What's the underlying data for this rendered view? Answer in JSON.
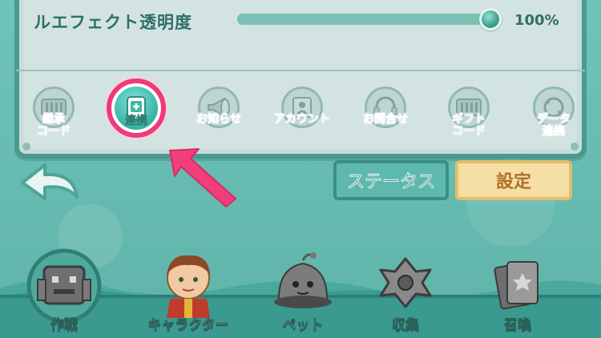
{
  "settings": {
    "effect_opacity_label": "ルエフェクト透明度",
    "effect_opacity_value": "100%",
    "effect_opacity_fraction": 1.0
  },
  "buttons": [
    {
      "label": "継承\nコード",
      "icon": "handover-code-icon",
      "active": false
    },
    {
      "label": "連携",
      "icon": "link-device-icon",
      "active": true
    },
    {
      "label": "お知らせ",
      "icon": "news-icon",
      "active": false
    },
    {
      "label": "アカウント",
      "icon": "account-icon",
      "active": false
    },
    {
      "label": "お問合せ",
      "icon": "support-icon",
      "active": false
    },
    {
      "label": "ギフト\nコード",
      "icon": "gift-code-icon",
      "active": false
    },
    {
      "label": "データ\n連携",
      "icon": "data-link-icon",
      "active": false
    }
  ],
  "tabs": {
    "status_label": "ステータス",
    "settings_label": "設定"
  },
  "nav": [
    {
      "label": "作戦",
      "icon": "battle-icon"
    },
    {
      "label": "キャラクター",
      "icon": "character-icon"
    },
    {
      "label": "ペット",
      "icon": "pet-icon"
    },
    {
      "label": "収集",
      "icon": "collect-icon"
    },
    {
      "label": "召喚",
      "icon": "summon-icon"
    }
  ],
  "colors": {
    "highlight": "#ef3a78",
    "panel": "#d3e3e2",
    "accent": "#3ea795"
  }
}
